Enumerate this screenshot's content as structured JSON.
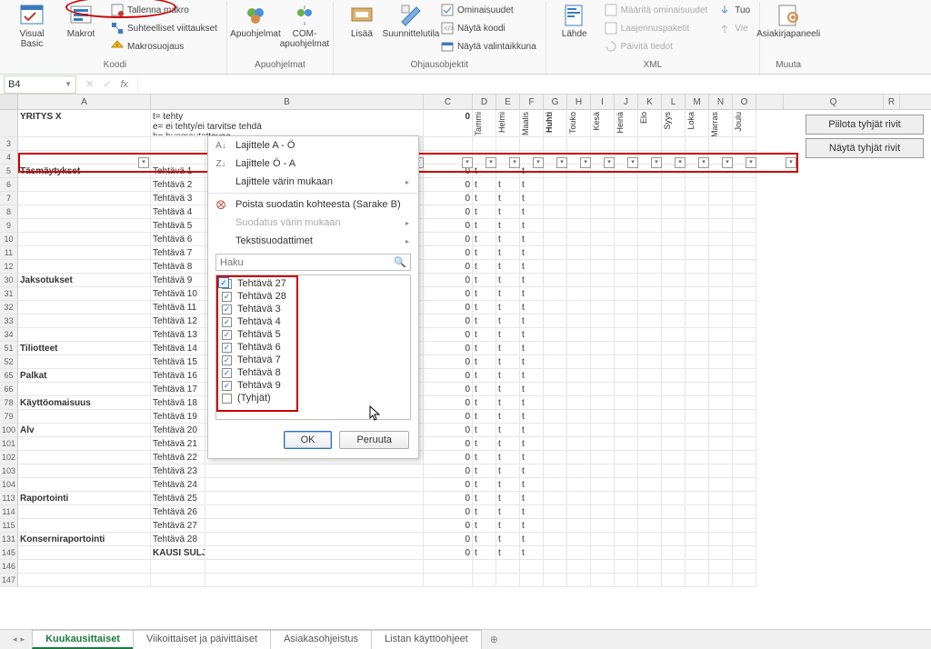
{
  "ribbon": {
    "groups": {
      "koodi": {
        "label": "Koodi",
        "visual_basic": "Visual\nBasic",
        "makrot": "Makrot",
        "tallenna_makro": "Tallenna makro",
        "suhteelliset": "Suhteelliset viittaukset",
        "makrosuojaus": "Makrosuojaus"
      },
      "apuohjelmat": {
        "label": "Apuohjelmat",
        "apuohjelmat_btn": "Apuohjelmat",
        "com": "COM-\napuohjelmat"
      },
      "ohjausobjektit": {
        "label": "Ohjausobjektit",
        "lisaa": "Lisää",
        "suunnittelutila": "Suunnittelutila",
        "ominaisuudet": "Ominaisuudet",
        "nayta_koodi": "Näytä koodi",
        "nayta_valinta": "Näytä valintaikkuna"
      },
      "xml": {
        "label": "XML",
        "lahde": "Lähde",
        "maarita": "Määritä ominaisuudet",
        "laajennus": "Laajennuspaketit",
        "paivita": "Päivitä tiedot",
        "tuo": "Tuo",
        "vie": "Vie"
      },
      "muuta": {
        "label": "Muuta",
        "asiakirja": "Asiakirjapaneeli"
      }
    }
  },
  "namebox": "B4",
  "fx_label": "fx",
  "col_headers": [
    "A",
    "B",
    "C",
    "D",
    "E",
    "F",
    "G",
    "H",
    "I",
    "J",
    "K",
    "L",
    "M",
    "N",
    "O",
    "Q",
    "R"
  ],
  "side_buttons": {
    "hide": "Piilota tyhjät rivit",
    "show": "Näytä tyhjät rivit"
  },
  "header_row": {
    "company": "YRITYS X",
    "legend": [
      "t= tehty",
      "e= ei tehty/ei tarvitse tehdä",
      "h= huomautettavaa"
    ],
    "zero": "0",
    "months": [
      "Tammi",
      "Helmi",
      "Maalis",
      "Huhti",
      "Touko",
      "Kesä",
      "Heinä",
      "Elo",
      "Syys",
      "Loka",
      "Marras",
      "Joulu"
    ]
  },
  "rows": [
    {
      "n": 3,
      "a": "",
      "b": ""
    },
    {
      "n": 4,
      "a": "",
      "b": ""
    },
    {
      "n": 5,
      "a": "Täsmäytykset",
      "b": "Tehtävä 1",
      "c": "0",
      "d": "t",
      "e": "",
      "f": "t",
      "struck": true
    },
    {
      "n": 6,
      "a": "",
      "b": "Tehtävä 2",
      "c": "0",
      "d": "t",
      "e": "t",
      "f": "t"
    },
    {
      "n": 7,
      "a": "",
      "b": "Tehtävä 3",
      "c": "0",
      "d": "t",
      "e": "t",
      "f": "t"
    },
    {
      "n": 8,
      "a": "",
      "b": "Tehtävä 4",
      "c": "0",
      "d": "t",
      "e": "t",
      "f": "t"
    },
    {
      "n": 9,
      "a": "",
      "b": "Tehtävä 5",
      "c": "0",
      "d": "t",
      "e": "t",
      "f": "t"
    },
    {
      "n": 10,
      "a": "",
      "b": "Tehtävä 6",
      "c": "0",
      "d": "t",
      "e": "t",
      "f": "t"
    },
    {
      "n": 11,
      "a": "",
      "b": "Tehtävä 7",
      "c": "0",
      "d": "t",
      "e": "t",
      "f": "t"
    },
    {
      "n": 12,
      "a": "",
      "b": "Tehtävä 8",
      "c": "0",
      "d": "t",
      "e": "t",
      "f": "t"
    },
    {
      "n": 30,
      "a": "Jaksotukset",
      "b": "Tehtävä 9",
      "c": "0",
      "d": "t",
      "e": "t",
      "f": "t"
    },
    {
      "n": 31,
      "a": "",
      "b": "Tehtävä 10",
      "c": "0",
      "d": "t",
      "e": "t",
      "f": "t"
    },
    {
      "n": 32,
      "a": "",
      "b": "Tehtävä 11",
      "c": "0",
      "d": "t",
      "e": "t",
      "f": "t"
    },
    {
      "n": 33,
      "a": "",
      "b": "Tehtävä 12",
      "c": "0",
      "d": "t",
      "e": "t",
      "f": "t"
    },
    {
      "n": 34,
      "a": "",
      "b": "Tehtävä 13",
      "c": "0",
      "d": "t",
      "e": "t",
      "f": "t"
    },
    {
      "n": 51,
      "a": "Tiliotteet",
      "b": "Tehtävä 14",
      "c": "0",
      "d": "t",
      "e": "t",
      "f": "t"
    },
    {
      "n": 52,
      "a": "",
      "b": "Tehtävä 15",
      "c": "0",
      "d": "t",
      "e": "t",
      "f": "t"
    },
    {
      "n": 65,
      "a": "Palkat",
      "b": "Tehtävä 16",
      "c": "0",
      "d": "t",
      "e": "t",
      "f": "t"
    },
    {
      "n": 66,
      "a": "",
      "b": "Tehtävä 17",
      "c": "0",
      "d": "t",
      "e": "t",
      "f": "t"
    },
    {
      "n": 78,
      "a": "Käyttöomaisuus",
      "b": "Tehtävä 18",
      "c": "0",
      "d": "t",
      "e": "t",
      "f": "t"
    },
    {
      "n": 79,
      "a": "",
      "b": "Tehtävä 19",
      "c": "0",
      "d": "t",
      "e": "t",
      "f": "t"
    },
    {
      "n": 100,
      "a": "Alv",
      "b": "Tehtävä 20",
      "c": "0",
      "d": "t",
      "e": "t",
      "f": "t"
    },
    {
      "n": 101,
      "a": "",
      "b": "Tehtävä 21",
      "c": "0",
      "d": "t",
      "e": "t",
      "f": "t"
    },
    {
      "n": 102,
      "a": "",
      "b": "Tehtävä 22",
      "c": "0",
      "d": "t",
      "e": "t",
      "f": "t"
    },
    {
      "n": 103,
      "a": "",
      "b": "Tehtävä 23",
      "c": "0",
      "d": "t",
      "e": "t",
      "f": "t"
    },
    {
      "n": 104,
      "a": "",
      "b": "Tehtävä 24",
      "c": "0",
      "d": "t",
      "e": "t",
      "f": "t"
    },
    {
      "n": 113,
      "a": "Raportointi",
      "b": "Tehtävä 25",
      "c": "0",
      "d": "t",
      "e": "t",
      "f": "t"
    },
    {
      "n": 114,
      "a": "",
      "b": "Tehtävä 26",
      "c": "0",
      "d": "t",
      "e": "t",
      "f": "t"
    },
    {
      "n": 115,
      "a": "",
      "b": "Tehtävä 27",
      "c": "0",
      "d": "t",
      "e": "t",
      "f": "t"
    },
    {
      "n": 131,
      "a": "Konserniraportointi",
      "b": "Tehtävä 28",
      "c": "0",
      "d": "t",
      "e": "t",
      "f": "t"
    },
    {
      "n": 145,
      "a": "",
      "b": "KAUSI SULJETTU",
      "c": "0",
      "d": "t",
      "e": "t",
      "f": "t",
      "boldB": true
    },
    {
      "n": 146,
      "a": "",
      "b": ""
    },
    {
      "n": 147,
      "a": "",
      "b": ""
    }
  ],
  "menu": {
    "sort_az": "Lajittele A - Ö",
    "sort_za": "Lajittele Ö - A",
    "sort_color": "Lajittele värin mukaan",
    "clear": "Poista suodatin kohteesta (Sarake B)",
    "filter_color": "Suodatus värin mukaan",
    "text_filters": "Tekstisuodattimet",
    "search_ph": "Haku",
    "checks": [
      {
        "label": "Tehtävä 27",
        "on": true
      },
      {
        "label": "Tehtävä 28",
        "on": true
      },
      {
        "label": "Tehtävä 3",
        "on": true
      },
      {
        "label": "Tehtävä 4",
        "on": true
      },
      {
        "label": "Tehtävä 5",
        "on": true
      },
      {
        "label": "Tehtävä 6",
        "on": true
      },
      {
        "label": "Tehtävä 7",
        "on": true
      },
      {
        "label": "Tehtävä 8",
        "on": true
      },
      {
        "label": "Tehtävä 9",
        "on": true
      },
      {
        "label": "(Tyhjät)",
        "on": false
      }
    ],
    "ok": "OK",
    "cancel": "Peruuta"
  },
  "tabs": {
    "items": [
      "Kuukausittaiset",
      "Viikoittaiset ja päivittäiset",
      "Asiakasohjeistus",
      "Listan käyttöohjeet"
    ],
    "active": 0
  }
}
